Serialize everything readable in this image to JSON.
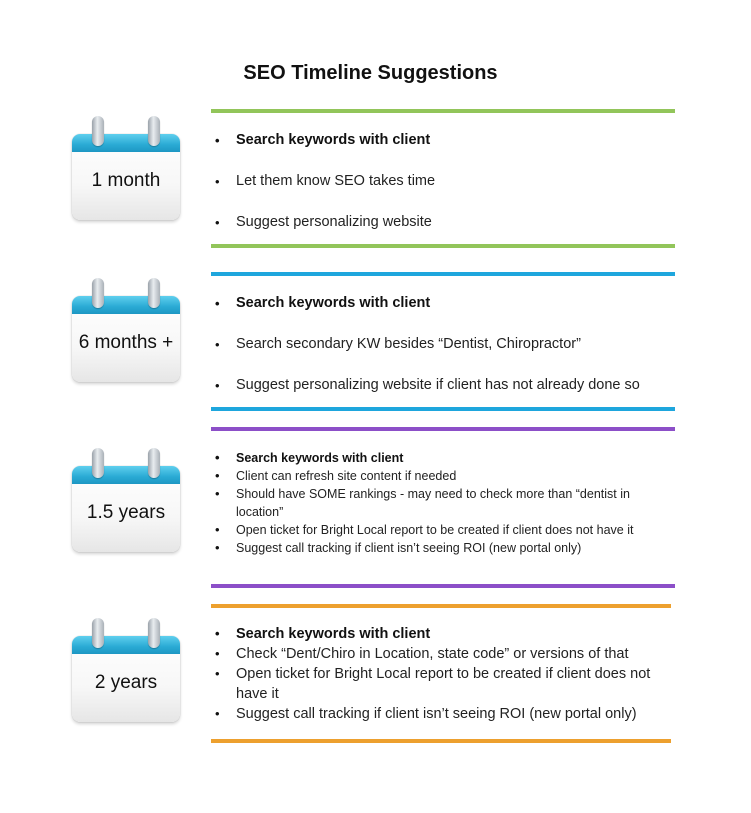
{
  "title": "SEO Timeline Suggestions",
  "colors": {
    "green": "#92c55a",
    "blue": "#1ea6dd",
    "purple": "#8c4fc8",
    "orange": "#eda02e",
    "calendar_band": "#2aaad4"
  },
  "sections": [
    {
      "period": "1 month",
      "items": [
        "Search keywords with client",
        "Let them know SEO takes time",
        "Suggest personalizing website"
      ]
    },
    {
      "period": "6 months +",
      "items": [
        "Search keywords with client",
        "Search secondary KW besides “Dentist, Chiropractor”",
        "Suggest personalizing website if client has not already done so"
      ]
    },
    {
      "period": "1.5 years",
      "items": [
        "Search keywords with client",
        "Client can refresh site content if needed",
        "Should have SOME rankings - may need to check more than “dentist in location”",
        "Open ticket for Bright Local report to be created if client does not have it",
        "Suggest call tracking if client isn’t seeing ROI (new portal only)"
      ]
    },
    {
      "period": "2 years",
      "items": [
        "Search keywords with client",
        "Check “Dent/Chiro in Location, state code” or versions of that",
        "Open ticket for Bright Local report to be created if client does not have it",
        "Suggest call tracking if client isn’t seeing ROI (new portal only)"
      ]
    }
  ]
}
